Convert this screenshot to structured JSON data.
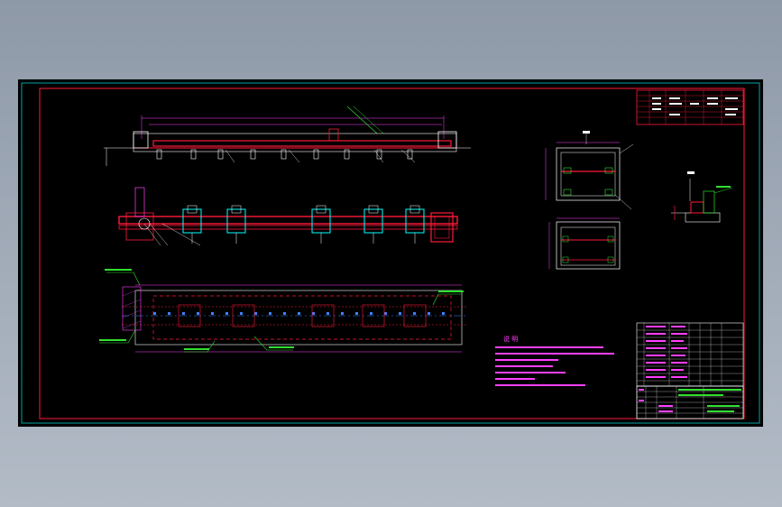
{
  "colors": {
    "background": "#000000",
    "frame": "#00d0d0",
    "outline": "#ff1a3a",
    "geometry": "#ffffff",
    "dimension": "#ff40ff",
    "annotation": "#30e030",
    "accent": "#00ffff"
  },
  "drawing": {
    "views": [
      {
        "name": "front-elevation"
      },
      {
        "name": "plan-view"
      },
      {
        "name": "foundation-plan"
      },
      {
        "name": "section-top"
      },
      {
        "name": "section-bottom"
      },
      {
        "name": "detail-view"
      }
    ],
    "notes": {
      "title": "说 明",
      "lines": [
        "1.",
        "2.",
        "3.",
        "4.",
        "5.",
        "6.",
        "7."
      ]
    },
    "title_block": {
      "rows": 6
    }
  }
}
